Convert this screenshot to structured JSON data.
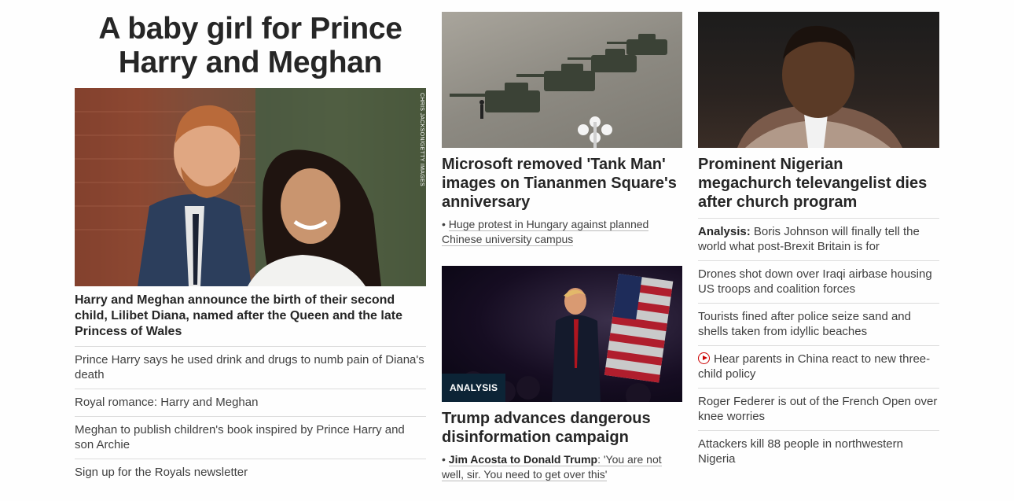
{
  "col1": {
    "title": "A baby girl for Prince Harry and Meghan",
    "image_credit": "CHRIS JACKSON/GETTY IMAGES",
    "lead": "Harry and Meghan announce the birth of their second child, Lilibet Diana, named after the Queen and the late Princess of Wales",
    "links": [
      "Prince Harry says he used drink and drugs to numb pain of Diana's death",
      "Royal romance: Harry and Meghan",
      "Meghan to publish children's book inspired by Prince Harry and son Archie",
      "Sign up for the Royals newsletter"
    ]
  },
  "col2": {
    "story1": {
      "headline": "Microsoft removed 'Tank Man' images on Tiananmen Square's anniversary",
      "bullet": "• ",
      "sub": "Huge protest in Hungary against planned Chinese university campus"
    },
    "story2": {
      "badge": "ANALYSIS",
      "headline": "Trump advances dangerous disinformation campaign",
      "bullet": "• ",
      "sub_bold": "Jim Acosta to Donald Trump",
      "sub_rest": ": 'You are not well, sir. You need to get over this'"
    }
  },
  "col3": {
    "headline": "Prominent Nigerian megachurch televangelist dies after church program",
    "links": [
      {
        "prefix": "Analysis:",
        "text": " Boris Johnson will finally tell the world what post-Brexit Britain is for"
      },
      {
        "text": "Drones shot down over Iraqi airbase housing US troops and coalition forces"
      },
      {
        "text": "Tourists fined after police seize sand and shells taken from idyllic beaches"
      },
      {
        "icon": "play-icon",
        "text": "Hear parents in China react to new three-child policy"
      },
      {
        "text": "Roger Federer is out of the French Open over knee worries"
      },
      {
        "text": "Attackers kill 88 people in northwestern Nigeria"
      }
    ]
  },
  "colors": {
    "text": "#262626",
    "secondary": "#404040",
    "divider": "#dcdcdc",
    "badge_bg": "#0c2436",
    "play_icon": "#cc0000"
  }
}
